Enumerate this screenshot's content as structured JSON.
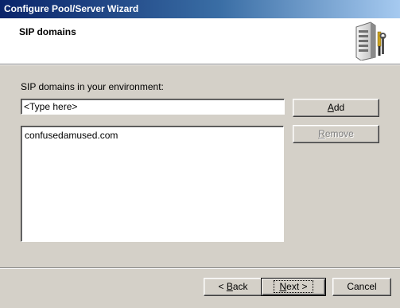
{
  "window": {
    "title": "Configure Pool/Server Wizard"
  },
  "header": {
    "heading": "SIP domains",
    "icon": "server-tools-icon"
  },
  "main": {
    "domains_label": "SIP domains in your environment:",
    "input": {
      "value": "<Type here>"
    },
    "domains": [
      "confusedamused.com"
    ],
    "add_button": {
      "mnemonic": "A",
      "rest": "dd"
    },
    "remove_button": {
      "mnemonic": "R",
      "rest": "emove",
      "enabled": false
    }
  },
  "footer": {
    "back_button": {
      "prefix": "< ",
      "mnemonic": "B",
      "rest": "ack"
    },
    "next_button": {
      "prefix": "",
      "mnemonic": "N",
      "rest": "ext >"
    },
    "cancel_button": {
      "label": "Cancel"
    }
  }
}
